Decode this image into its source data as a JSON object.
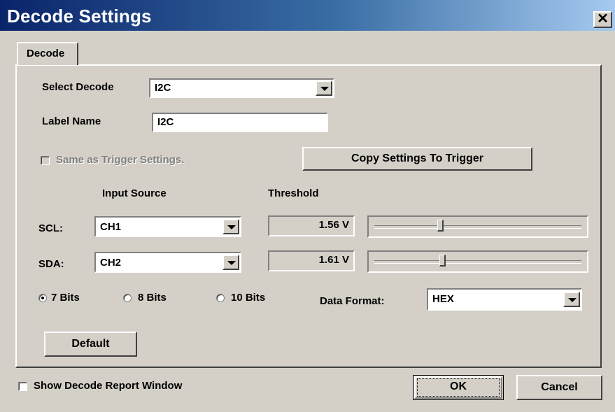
{
  "window": {
    "title": "Decode Settings",
    "close_symbol": "✕"
  },
  "tabs": [
    {
      "label": "Decode",
      "active": true
    }
  ],
  "select_decode": {
    "label": "Select Decode",
    "value": "I2C"
  },
  "label_name": {
    "label": "Label Name",
    "value": "I2C"
  },
  "same_as_trigger": {
    "label": "Same as Trigger Settings.",
    "checked": false,
    "enabled": false
  },
  "copy_settings_button": {
    "label": "Copy Settings To Trigger"
  },
  "headers": {
    "input_source": "Input Source",
    "threshold": "Threshold"
  },
  "channels": [
    {
      "label": "SCL:",
      "source": "CH1",
      "threshold": "1.56 V",
      "slider_level": 0.2
    },
    {
      "label": "SDA:",
      "source": "CH2",
      "threshold": "1.61 V",
      "slider_level": 0.3
    }
  ],
  "bits": {
    "options": [
      "7 Bits",
      "8 Bits",
      "10 Bits"
    ],
    "selected": "7 Bits"
  },
  "data_format": {
    "label": "Data Format:",
    "value": "HEX"
  },
  "default_button": {
    "label": "Default"
  },
  "show_report": {
    "label": "Show Decode Report Window",
    "checked": false
  },
  "footer_buttons": {
    "ok": "OK",
    "cancel": "Cancel"
  },
  "colors": {
    "face": "#d4d0c8",
    "title_start": "#0a246a",
    "title_end": "#a6caf0"
  }
}
